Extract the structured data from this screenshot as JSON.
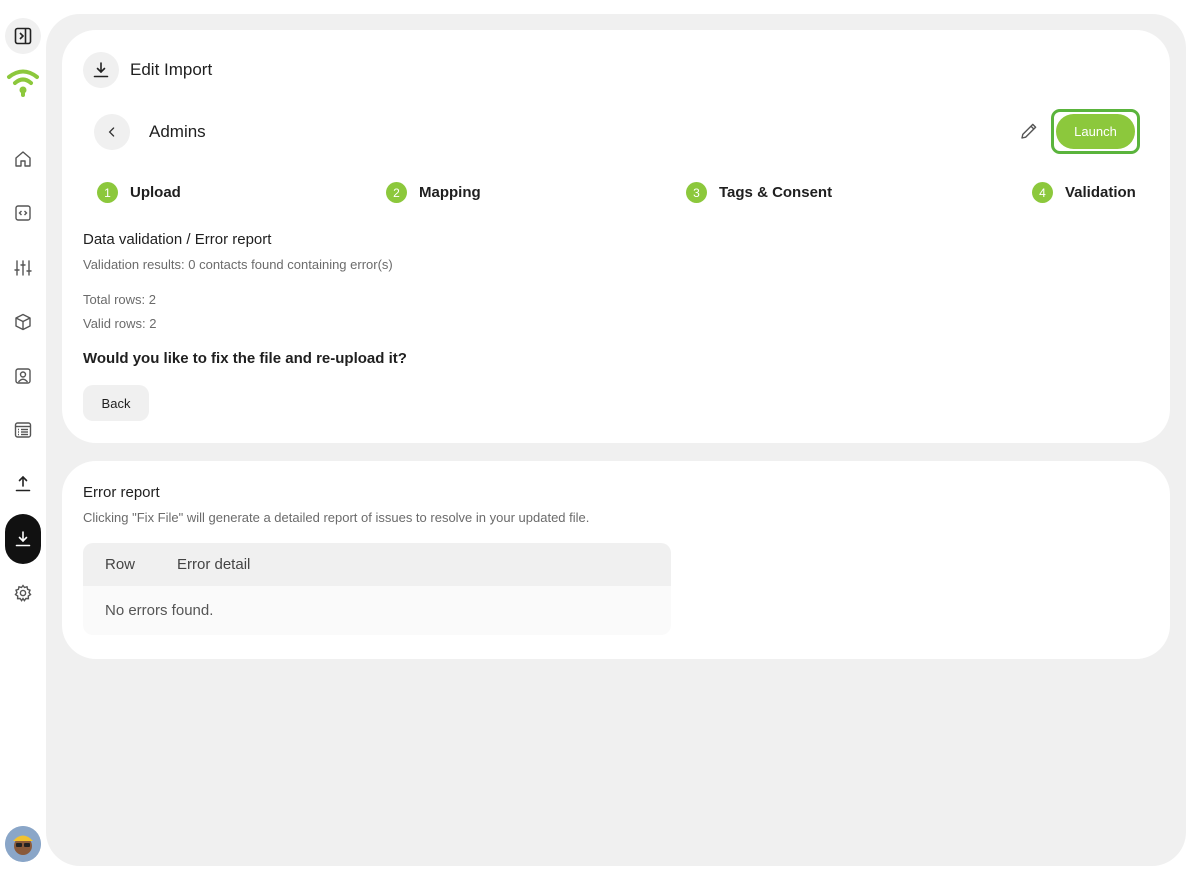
{
  "app": {
    "accent_color": "#8cc83c",
    "active_nav": "import"
  },
  "sidebar": {
    "items": [
      {
        "icon": "sidebar-toggle-icon"
      },
      {
        "icon": "wifi-logo-icon"
      },
      {
        "icon": "home-icon"
      },
      {
        "icon": "code-icon"
      },
      {
        "icon": "sliders-icon"
      },
      {
        "icon": "cube-icon"
      },
      {
        "icon": "contact-card-icon"
      },
      {
        "icon": "list-icon"
      },
      {
        "icon": "upload-icon"
      },
      {
        "icon": "download-icon"
      },
      {
        "icon": "gear-icon"
      }
    ]
  },
  "header": {
    "title": "Edit Import",
    "icon": "download-icon"
  },
  "toolbar": {
    "list_name": "Admins",
    "launch_label": "Launch"
  },
  "steps": [
    {
      "num": "1",
      "label": "Upload"
    },
    {
      "num": "2",
      "label": "Mapping"
    },
    {
      "num": "3",
      "label": "Tags & Consent"
    },
    {
      "num": "4",
      "label": "Validation"
    }
  ],
  "validation": {
    "title": "Data validation / Error report",
    "subtitle": "Validation results: 0 contacts found containing error(s)",
    "total_rows": "Total rows: 2",
    "valid_rows": "Valid rows: 2",
    "question": "Would you like to fix the file and re-upload it?",
    "back_label": "Back"
  },
  "error_report": {
    "title": "Error report",
    "subtitle": "Clicking \"Fix File\" will generate a detailed report of issues to resolve in your updated file.",
    "columns": [
      "Row",
      "Error detail"
    ],
    "empty_text": "No errors found."
  }
}
